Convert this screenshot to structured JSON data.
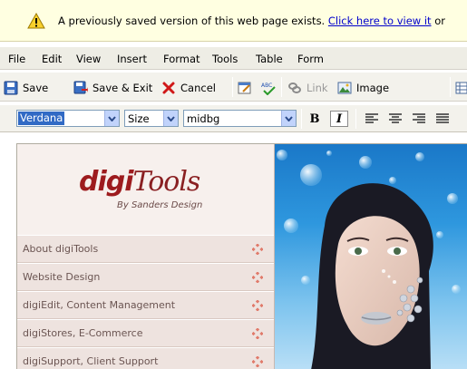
{
  "infobar": {
    "message": "A previously saved version of this web page exists.",
    "link_text": "Click here to view it",
    "trailing": "or"
  },
  "menu": [
    "File",
    "Edit",
    "View",
    "Insert",
    "Format",
    "Tools",
    "Table",
    "Form"
  ],
  "toolbar": {
    "save": "Save",
    "save_exit": "Save & Exit",
    "cancel": "Cancel",
    "link": "Link",
    "image": "Image"
  },
  "format_bar": {
    "font_value": "Verdana",
    "size_value": "Size",
    "class_value": "midbg",
    "bold": "B",
    "italic": "I"
  },
  "site": {
    "logo_digi": "digi",
    "logo_tools": "Tools",
    "logo_byline": "By Sanders Design",
    "nav": [
      {
        "label": "About digiTools"
      },
      {
        "label": "Website Design"
      },
      {
        "label": "digiEdit, Content Management"
      },
      {
        "label": "digiStores, E-Commerce"
      },
      {
        "label": "digiSupport, Client Support"
      }
    ]
  },
  "colors": {
    "infobar_bg": "#ffffe1",
    "link": "#0000cc",
    "brand": "#9d1b1e",
    "nav_bg": "#eee3df",
    "nav_text": "#6b5552"
  }
}
